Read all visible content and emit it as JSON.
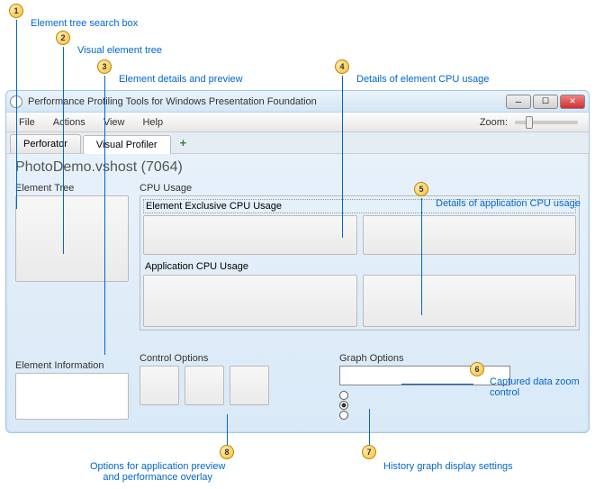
{
  "callouts": {
    "c1": "Element tree search box",
    "c2": "Visual element tree",
    "c3": "Element details and preview",
    "c4": "Details of element CPU usage",
    "c5": "Details of application CPU usage",
    "c6": "Captured data zoom control",
    "c7": "History graph display settings",
    "c8": "Options for application preview\nand performance overlay"
  },
  "window": {
    "title": "Performance Profiling Tools for Windows Presentation Foundation",
    "menu": {
      "file": "File",
      "actions": "Actions",
      "view": "View",
      "help": "Help",
      "zoom": "Zoom:"
    },
    "tabs": {
      "perforator": "Perforator",
      "visual_profiler": "Visual Profiler",
      "add": "+"
    },
    "heading": "PhotoDemo.vshost (7064)",
    "left": {
      "tree_label": "Element Tree",
      "info_label": "Element Information"
    },
    "cpu": {
      "section": "CPU Usage",
      "exclusive": "Element Exclusive CPU Usage",
      "app": "Application CPU Usage"
    },
    "bottom": {
      "control": "Control Options",
      "graph": "Graph Options"
    }
  }
}
